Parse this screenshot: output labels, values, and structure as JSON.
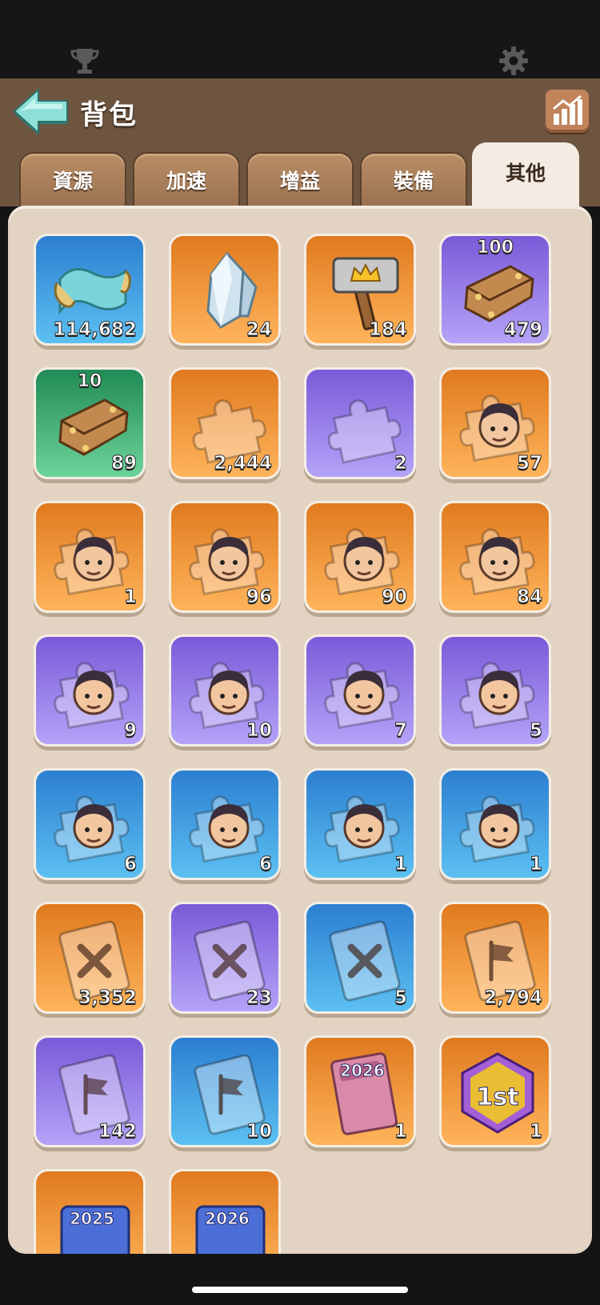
{
  "header": {
    "title": "背包"
  },
  "tabs": [
    {
      "label": "資源",
      "active": false
    },
    {
      "label": "加速",
      "active": false
    },
    {
      "label": "增益",
      "active": false
    },
    {
      "label": "裝備",
      "active": false
    },
    {
      "label": "其他",
      "active": true
    }
  ],
  "items": [
    {
      "name": "scroll-item",
      "icon": "scroll-icon",
      "bg": "blue",
      "count": "114,682"
    },
    {
      "name": "crystal-item",
      "icon": "crystal-icon",
      "bg": "orange",
      "count": "24"
    },
    {
      "name": "crown-hammer-item",
      "icon": "hammer-icon",
      "bg": "orange",
      "count": "184"
    },
    {
      "name": "wood-plank-item",
      "icon": "plank-icon",
      "bg": "purple",
      "count": "479",
      "tag": "100"
    },
    {
      "name": "wood-plank-item",
      "icon": "plank-icon",
      "bg": "green",
      "count": "89",
      "tag": "10"
    },
    {
      "name": "puzzle-piece-item",
      "icon": "puzzle-icon",
      "bg": "orange",
      "count": "2,444"
    },
    {
      "name": "puzzle-piece-item",
      "icon": "puzzle-icon",
      "bg": "purple",
      "count": "2"
    },
    {
      "name": "hero-fragment-item",
      "icon": "hero-portrait-icon",
      "bg": "orange",
      "count": "57"
    },
    {
      "name": "hero-fragment-item",
      "icon": "hero-portrait-icon",
      "bg": "orange",
      "count": "1"
    },
    {
      "name": "hero-fragment-item",
      "icon": "hero-portrait-icon",
      "bg": "orange",
      "count": "96"
    },
    {
      "name": "hero-fragment-item",
      "icon": "hero-portrait-icon",
      "bg": "orange",
      "count": "90"
    },
    {
      "name": "hero-fragment-item",
      "icon": "hero-portrait-icon",
      "bg": "orange",
      "count": "84"
    },
    {
      "name": "hero-fragment-item",
      "icon": "hero-portrait-icon",
      "bg": "purple",
      "count": "9"
    },
    {
      "name": "hero-fragment-item",
      "icon": "hero-portrait-icon",
      "bg": "purple",
      "count": "10"
    },
    {
      "name": "hero-fragment-item",
      "icon": "hero-portrait-icon",
      "bg": "purple",
      "count": "7"
    },
    {
      "name": "hero-fragment-item",
      "icon": "hero-portrait-icon",
      "bg": "purple",
      "count": "5"
    },
    {
      "name": "hero-fragment-item",
      "icon": "hero-portrait-icon",
      "bg": "blue",
      "count": "6"
    },
    {
      "name": "hero-fragment-item",
      "icon": "hero-portrait-icon",
      "bg": "blue",
      "count": "6"
    },
    {
      "name": "hero-fragment-item",
      "icon": "hero-portrait-icon",
      "bg": "blue",
      "count": "1"
    },
    {
      "name": "hero-fragment-item",
      "icon": "hero-portrait-icon",
      "bg": "blue",
      "count": "1"
    },
    {
      "name": "skill-book-item",
      "icon": "sword-book-icon",
      "bg": "orange",
      "count": "3,352"
    },
    {
      "name": "skill-book-item",
      "icon": "sword-book-icon",
      "bg": "purple",
      "count": "23"
    },
    {
      "name": "skill-book-item",
      "icon": "sword-book-icon",
      "bg": "blue",
      "count": "5"
    },
    {
      "name": "flag-book-item",
      "icon": "flag-book-icon",
      "bg": "orange",
      "count": "2,794"
    },
    {
      "name": "flag-book-item",
      "icon": "flag-book-icon",
      "bg": "purple",
      "count": "142"
    },
    {
      "name": "flag-book-item",
      "icon": "flag-book-icon",
      "bg": "blue",
      "count": "10"
    },
    {
      "name": "journal-2026-item",
      "icon": "journal-icon",
      "bg": "orange",
      "count": "1",
      "label": "2026"
    },
    {
      "name": "first-place-badge-item",
      "icon": "first-badge-icon",
      "bg": "orange",
      "count": "1",
      "label": "1st"
    },
    {
      "name": "year-2025-item",
      "icon": "year-badge-icon",
      "bg": "orange",
      "count": "",
      "label": "2025"
    },
    {
      "name": "year-2026-item",
      "icon": "year-badge-icon",
      "bg": "orange",
      "count": "",
      "label": "2026"
    }
  ],
  "colors": {
    "header_bg": "#6e5540",
    "panel_bg": "#e2d3c2",
    "tab_bg": "#a67a55",
    "tab_active_bg": "#f4ece2",
    "back_arrow": "#7fd6d0"
  }
}
